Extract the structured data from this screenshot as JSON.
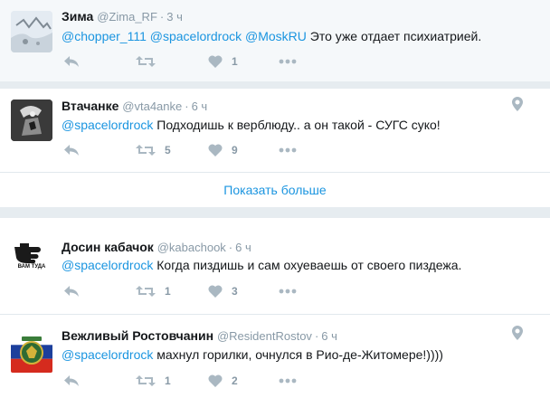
{
  "tweets": [
    {
      "name": "Зима",
      "handle": "@Zima_RF",
      "time": "3 ч",
      "mentions": "@chopper_111 @spacelordrock @MoskRU",
      "text": " Это уже отдает психиатрией.",
      "retweets": "",
      "likes": "1",
      "avatar": "winter-scene"
    },
    {
      "name": "Втачанке",
      "handle": "@vta4anke",
      "time": "6 ч",
      "mentions": "@spacelordrock",
      "text": " Подходишь к верблюду.. а он такой - СУГС суко!",
      "retweets": "5",
      "likes": "9",
      "avatar": "dark-sketch"
    },
    {
      "name": "Досин кабачок",
      "handle": "@kabachook",
      "time": "6 ч",
      "mentions": "@spacelordrock",
      "text": " Когда пиздишь и сам охуеваешь от своего пиздежа.",
      "retweets": "1",
      "likes": "3",
      "avatar": "pointing-hand",
      "avatar_caption": "ВАМ ТУДА"
    },
    {
      "name": "Вежливый Ростовчанин",
      "handle": "@ResidentRostov",
      "time": "6 ч",
      "mentions": "@spacelordrock",
      "text": " махнул горилки, очнулся в Рио-де-Житомере!))))",
      "retweets": "1",
      "likes": "2",
      "avatar": "flag-emblem"
    }
  ],
  "show_more_label": "Показать больше",
  "dot": "·",
  "colors": {
    "link": "#1b95e0",
    "muted": "#8899a6",
    "icon": "#aab8c2",
    "background": "#e6ecf0"
  }
}
